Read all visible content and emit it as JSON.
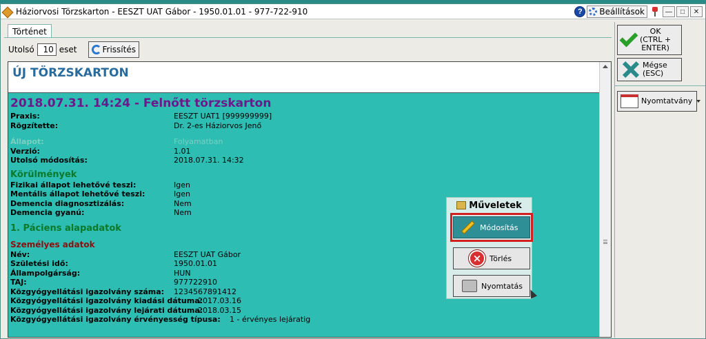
{
  "window": {
    "title": "Háziorvosi Törzskarton - EESZT UAT Gábor - 1950.01.01 - 977-722-910",
    "help_label": "?",
    "settings_label": "Beállítások",
    "minimize_label": "—",
    "maximize_label": "□",
    "close_label": "✕"
  },
  "tabs": [
    {
      "label": "Történet"
    }
  ],
  "toolbar": {
    "last_label": "Utolsó",
    "count_value": "10",
    "items_label": "eset",
    "refresh_label": "Frissítés"
  },
  "content": {
    "new_card_title": "ÚJ TÖRZSKARTON",
    "record": {
      "title": "2018.07.31. 14:24 - Felnőtt törzskarton",
      "header_rows": [
        {
          "key": "Praxis:",
          "value": "EESZT UAT1 [999999999]"
        },
        {
          "key": "Rögzítette:",
          "value": "Dr. 2-es Háziorvos Jenő"
        }
      ],
      "status_row": {
        "key": "Állapot:",
        "value": "Folyamatban"
      },
      "meta_rows": [
        {
          "key": "Verzió:",
          "value": "1.01"
        },
        {
          "key": "Utolsó módosítás:",
          "value": "2018.07.31. 14:32"
        }
      ],
      "circumstances_title": "Körülmények",
      "circumstances_rows": [
        {
          "key": "Fizikai állapot lehetővé teszi:",
          "value": "Igen"
        },
        {
          "key": "Mentális állapot lehetővé teszi:",
          "value": "Igen"
        },
        {
          "key": "Demencia diagnosztizálás:",
          "value": "Nem"
        },
        {
          "key": "Demencia gyanú:",
          "value": "Nem"
        }
      ],
      "patient_section_title": "1. Páciens alapadatok",
      "personal_title": "Személyes adatok",
      "personal_rows": [
        {
          "key": "Név:",
          "value": "EESZT UAT Gábor"
        },
        {
          "key": "Születési idő:",
          "value": "1950.01.01"
        },
        {
          "key": "Állampolgárság:",
          "value": "HUN"
        },
        {
          "key": "TAJ:",
          "value": "977722910"
        },
        {
          "key": "Közgyógyellátási igazolvány száma:",
          "value": "1234567891412"
        }
      ],
      "issue_row": {
        "key": "Közgyógyellátási igazolvány kiadási dátuma:",
        "value": "2017.03.16"
      },
      "expiry_row": {
        "key": "Közgyógyellátási igazolvány lejárati dátuma:",
        "value": "2018.03.15"
      },
      "validity_row": {
        "key": "Közgyógyellátási igazolvány érvényesség típusa:",
        "value": "1 - érvényes lejáratig"
      }
    }
  },
  "operations": {
    "title": "Műveletek",
    "edit_label": "Módosítás",
    "delete_label": "Törlés",
    "print_label": "Nyomtatás"
  },
  "sidebar": {
    "ok_label_line1": "OK",
    "ok_label_line2": "(CTRL +",
    "ok_label_line3": "ENTER)",
    "cancel_label_line1": "Mégse",
    "cancel_label_line2": "(ESC)",
    "print_form_label": "Nyomtatvány"
  }
}
